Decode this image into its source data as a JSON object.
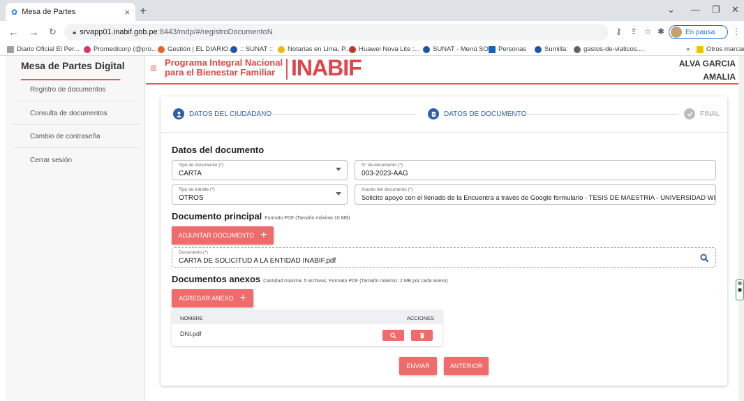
{
  "browser": {
    "tab_title": "Mesa de Partes",
    "tab_close": "×",
    "new_tab": "+",
    "url_host": "srvapp01.inabif.gob.pe",
    "url_path": ":8443/mdp/#/registroDocumentoN",
    "profile_label": "En pausa",
    "bookmarks": [
      {
        "label": "Diario Oficial El Per...",
        "color": "#9aa0a6"
      },
      {
        "label": "Promedicorp (@pro...",
        "color": "#e1306c"
      },
      {
        "label": "Gestión | EL DIARIO...",
        "color": "#e8622b"
      },
      {
        "label": ":: SUNAT ::",
        "color": "#1a56a8"
      },
      {
        "label": "Notarias en Lima, P...",
        "color": "#f2b600"
      },
      {
        "label": "Huawei Nova Lite :...",
        "color": "#c0392b"
      },
      {
        "label": "SUNAT - Menú SOL",
        "color": "#1a56a8"
      },
      {
        "label": "Personas",
        "color": "#1565c0"
      },
      {
        "label": "Sumilla:",
        "color": "#1a56a8"
      },
      {
        "label": "gastos-de-viaticos....",
        "color": "#5f6368"
      }
    ],
    "bookmarks_more": "»",
    "other_bookmarks": "Otros marcadores"
  },
  "sidebar": {
    "title": "Mesa de Partes Digital",
    "items": [
      {
        "label": "Registro de documentos"
      },
      {
        "label": "Consulta de documentos"
      },
      {
        "label": "Cambio de contraseña"
      },
      {
        "label": "Cerrar sesión"
      }
    ]
  },
  "header": {
    "logo_line1": "Programa Integral Nacional",
    "logo_line2": "para el Bienestar Familiar",
    "logo_big": "INABIF",
    "user_line1": "ALVA GARCIA",
    "user_line2": "AMALIA"
  },
  "stepper": {
    "steps": [
      {
        "label": "DATOS DEL CIUDADANO",
        "icon": "person-icon",
        "state": "active"
      },
      {
        "label": "DATOS DE DOCUMENTO",
        "icon": "document-icon",
        "state": "active"
      },
      {
        "label": "FINAL",
        "icon": "check-icon",
        "state": "pending"
      }
    ]
  },
  "form": {
    "section_title": "Datos del documento",
    "tipo_documento": {
      "label": "Tipo de documento (*)",
      "value": "CARTA"
    },
    "numero_documento": {
      "label": "N° de documento (*)",
      "value": "003-2023-AAG"
    },
    "tipo_tramite": {
      "label": "Tipo de trámite (*)",
      "value": "OTROS"
    },
    "asunto": {
      "label": "Asunto del documento (*)",
      "value": "Solicito apoyo con el llenado de la Encuentra a través de Google formulario - TESIS DE MAESTRIA - UNIVERSIDAD WIENER"
    }
  },
  "principal": {
    "title": "Documento principal",
    "note": "Formato PDF (Tamaño máximo 10 MB)",
    "attach_button": "ADJUNTAR DOCUMENTO",
    "doc_label": "Documento (*)",
    "doc_value": "CARTA DE SOLICITUD A LA ENTIDAD INABIF.pdf"
  },
  "anexos": {
    "title": "Documentos anexos",
    "note": "Cantidad máxima: 5 archivos. Formato PDF (Tamaño máximo: 2 MB por cada anexo)",
    "add_button": "AGREGAR ANEXO",
    "columns": [
      "NOMBRE",
      "ACCIONES"
    ],
    "rows": [
      {
        "name": "DNI.pdf"
      }
    ]
  },
  "actions": {
    "send": "ENVIAR",
    "back": "ANTERIOR"
  },
  "colors": {
    "accent": "#f06b6b",
    "brand_red": "#e0454a",
    "step_blue": "#2c5fa8"
  }
}
